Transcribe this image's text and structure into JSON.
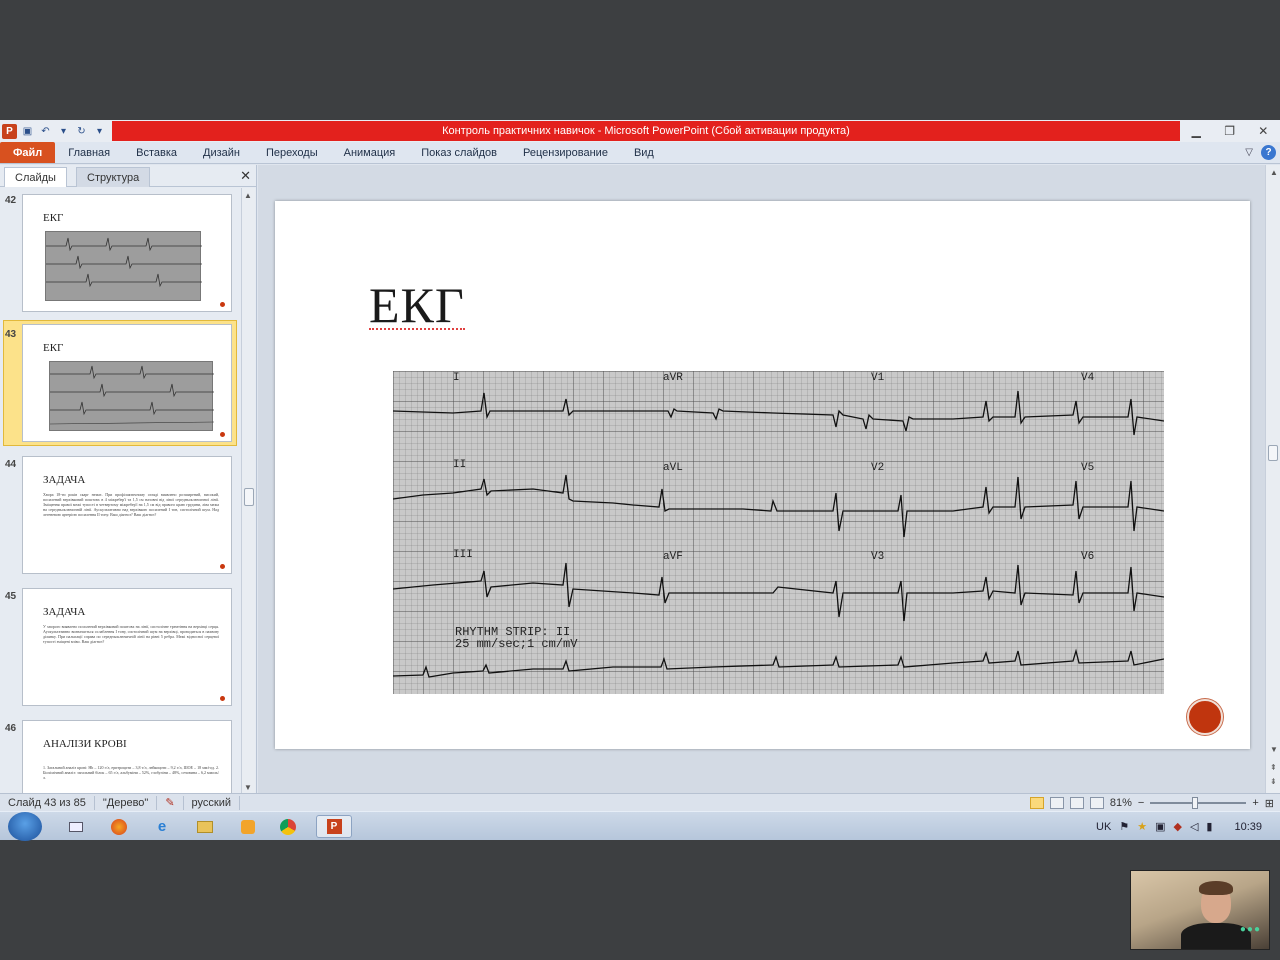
{
  "window": {
    "title": "Контроль практичних навичок  -  Microsoft PowerPoint (Сбой активации продукта)",
    "app_icon": "P",
    "minimize": "▁",
    "restore": "❐",
    "close": "✕"
  },
  "ribbon": {
    "tabs": [
      "Файл",
      "Главная",
      "Вставка",
      "Дизайн",
      "Переходы",
      "Анимация",
      "Показ слайдов",
      "Рецензирование",
      "Вид"
    ],
    "help": "?",
    "collapse": "▽"
  },
  "panel": {
    "tab_slides": "Слайды",
    "tab_outline": "Структура",
    "close": "✕",
    "thumbnails": [
      {
        "num": "42",
        "title": "ЕКГ",
        "type": "ecg"
      },
      {
        "num": "43",
        "title": "ЕКГ",
        "type": "ecg",
        "selected": true
      },
      {
        "num": "44",
        "title": "ЗАДАЧА",
        "type": "text",
        "body": "Хвора 18-ти років скарг немає. При профілактичному огляді виявлено розширений, високий, посилений верхівковий поштовх в 4 міжребер'ї та 1,5 см назовні від лівої середньоключичної лінії. Зміщення правої межі тупості в четвертому міжребер'ї на 1,5 см від правого краю грудини, ліва межа на середньоключичній лінії. Аускультативно над верхівкою посилений І тон, систолічний шум. Над легеневою артерією посилення ІІ тону. Ваш діагноз? Ваш діагноз?"
      },
      {
        "num": "45",
        "title": "ЗАДАЧА",
        "type": "text",
        "body": "У хворого виявлено посилений верхівковий поштовх на лінії, систолічне тремтіння на верхівці серця. Аускультативно визначається ослаблення І тону, систолічний шум на верхівці, проводиться в пахвову ділянку. При пальпації справа по середньоключичній лінії на рівні 5 ребра. Межі відносної серцевої тупості зміщені вліво. Ваш діагноз?"
      },
      {
        "num": "46",
        "title": "АНАЛІЗИ КРОВІ",
        "type": "text",
        "body": "1. Загальний аналіз крові: Hb – 120 г/л, еритроцити – 3,8 т/л, лейкоцити – 9,2 г/л, ШОЕ – 18 мм/год. 2. Біохімічний аналіз: загальний білок – 65 г/л, альбуміни – 52%, глобуліни – 48%, сечовина – 6,2 ммоль/л."
      }
    ]
  },
  "slide": {
    "title": "ЕКГ",
    "ecg": {
      "leads": [
        "I",
        "aVR",
        "V1",
        "V4",
        "II",
        "aVL",
        "V2",
        "V5",
        "III",
        "aVF",
        "V3",
        "V6"
      ],
      "rhythm_label_1": "RHYTHM STRIP: II",
      "rhythm_label_2": "25 mm/sec;1 cm/mV"
    }
  },
  "status": {
    "slide_counter": "Слайд 43 из 85",
    "theme": "\"Дерево\"",
    "language": "русский",
    "zoom": "81%",
    "zoom_minus": "−",
    "zoom_plus": "+"
  },
  "taskbar": {
    "lang": "UK",
    "time": "10:39"
  },
  "colors": {
    "title_bar": "#e3211d",
    "file_tab": "#d8511f",
    "selected_thumb": "#fce28a",
    "action_button": "#c0350e"
  }
}
